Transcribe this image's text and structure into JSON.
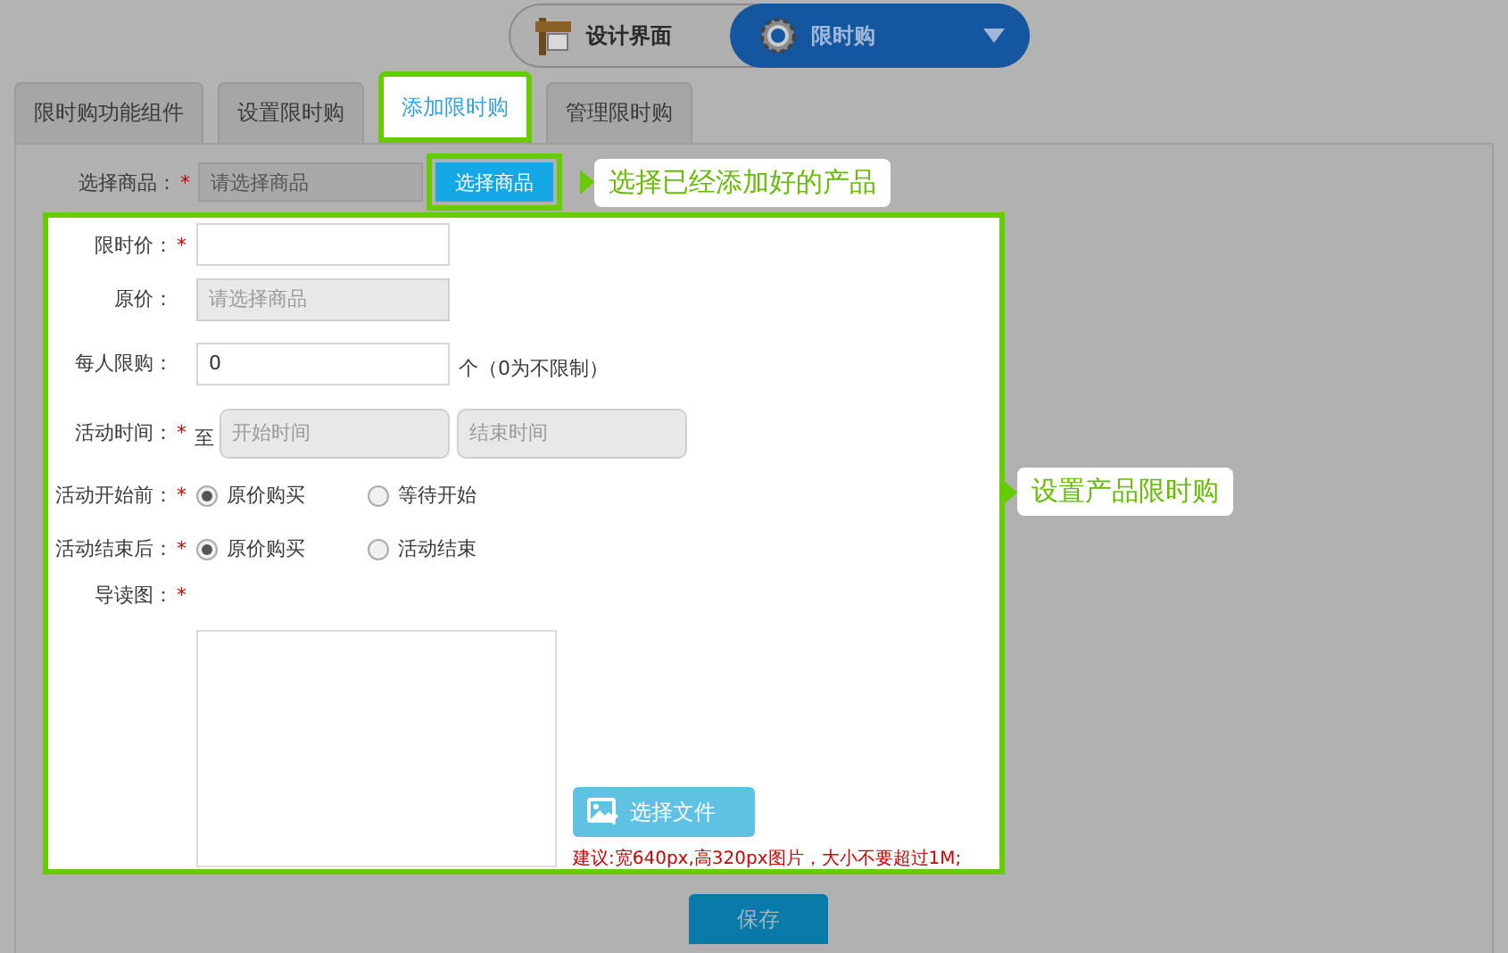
{
  "mode_switch": [
    {
      "label": "设计界面",
      "selected": false
    },
    {
      "label": "限时购",
      "selected": true
    }
  ],
  "tabs": [
    {
      "label": "限时购功能组件",
      "selected": false
    },
    {
      "label": "设置限时购",
      "selected": false
    },
    {
      "label": "添加限时购",
      "selected": true
    },
    {
      "label": "管理限时购",
      "selected": false
    }
  ],
  "product_row": {
    "label": "选择商品：",
    "mark": "*",
    "placeholder": "请选择商品",
    "disabled": true,
    "button": "选择商品",
    "callout": "选择已经添加好的产品"
  },
  "form": {
    "callout": "设置产品限时购",
    "fields": [
      {
        "kind": "text",
        "label": "限时价：",
        "mark": "*",
        "disabled": false
      },
      {
        "kind": "text",
        "label": "原价：",
        "placeholder": "请选择商品",
        "disabled": true
      },
      {
        "kind": "text",
        "label": "每人限购：",
        "value": "0",
        "disabled": false,
        "suffix": "个（0为不限制）"
      },
      {
        "kind": "daterange",
        "label": "活动时间：",
        "mark": "*",
        "prefix": "至",
        "start_placeholder": "开始时间",
        "end_placeholder": "结束时间",
        "disabled": true
      },
      {
        "kind": "radio",
        "label": "活动开始前：",
        "mark": "*",
        "options": [
          {
            "label": "原价购买",
            "checked": true
          },
          {
            "label": "等待开始",
            "checked": false
          }
        ]
      },
      {
        "kind": "radio",
        "label": "活动结束后：",
        "mark": "*",
        "options": [
          {
            "label": "原价购买",
            "checked": true
          },
          {
            "label": "活动结束",
            "checked": false
          }
        ]
      },
      {
        "kind": "image",
        "label": "导读图：",
        "mark": "*",
        "button": "选择文件",
        "hint": "建议:宽640px,高320px图片，大小不要超过1M;"
      }
    ]
  },
  "save_button": "保存"
}
